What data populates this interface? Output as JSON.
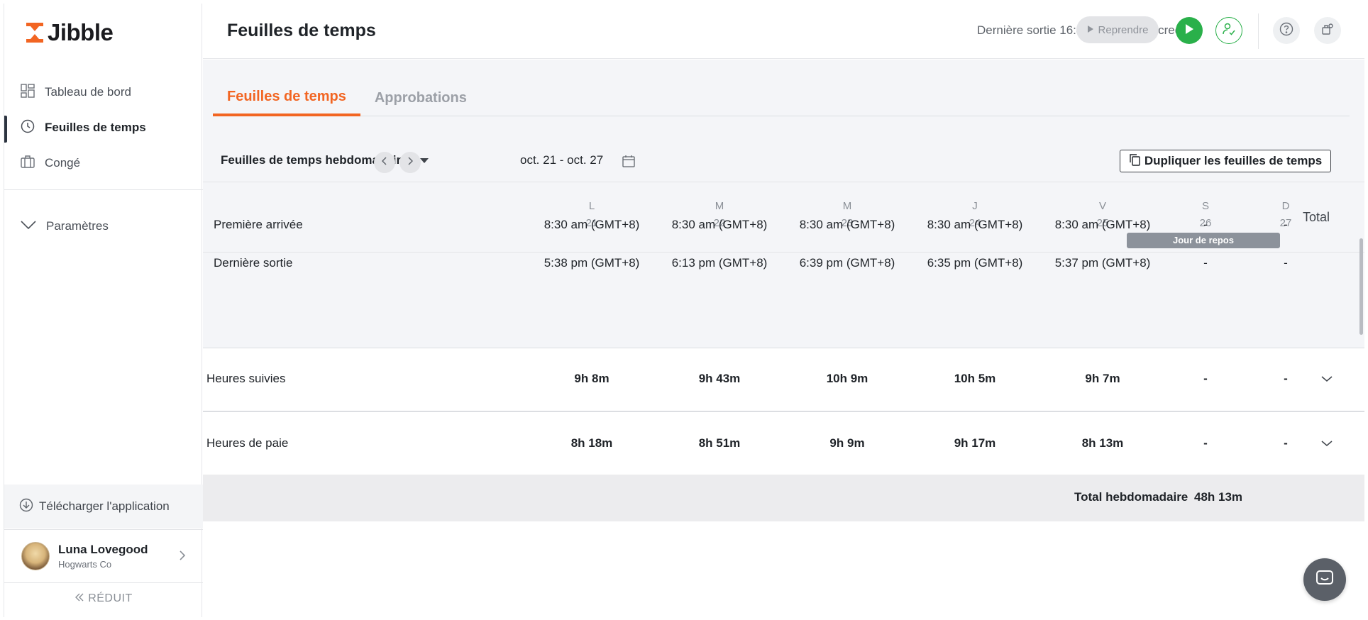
{
  "app": {
    "logo_text": "Jibble",
    "brand_color": "#f26522"
  },
  "sidebar": {
    "items": [
      {
        "label": "Tableau de bord",
        "icon": "dashboard-icon"
      },
      {
        "label": "Feuilles de temps",
        "icon": "clock-icon",
        "active": true
      },
      {
        "label": "Congé",
        "icon": "suitcase-icon"
      }
    ],
    "settings_label": "Paramètres",
    "download_label": "Télécharger l'application",
    "user": {
      "name": "Luna Lovegood",
      "org": "Hogwarts Co"
    },
    "collapse_label": "RÉDUIT"
  },
  "header": {
    "title": "Feuilles de temps",
    "last_out": "Dernière sortie 16:41, dernier mercredi",
    "resume_label": "Reprendre"
  },
  "tabs": [
    {
      "label": "Feuilles de temps",
      "active": true
    },
    {
      "label": "Approbations",
      "active": false
    }
  ],
  "toolbar": {
    "period": "Feuilles de temps hebdomadaires",
    "date_range": "oct. 21 - oct. 27",
    "duplicate_label": "Dupliquer les feuilles de temps"
  },
  "days": [
    {
      "letter": "L",
      "num": "21"
    },
    {
      "letter": "M",
      "num": "22"
    },
    {
      "letter": "M",
      "num": "23"
    },
    {
      "letter": "J",
      "num": "24"
    },
    {
      "letter": "V",
      "num": "25"
    },
    {
      "letter": "S",
      "num": "26"
    },
    {
      "letter": "D",
      "num": "27"
    }
  ],
  "total_header": "Total",
  "rest_badge": "Jour de repos",
  "rows": {
    "first_in": {
      "label": "Première arrivée",
      "values": [
        "8:30 am (GMT+8)",
        "8:30 am (GMT+8)",
        "8:30 am (GMT+8)",
        "8:30 am (GMT+8)",
        "8:30 am (GMT+8)",
        "-",
        "-"
      ]
    },
    "last_out": {
      "label": "Dernière sortie",
      "values": [
        "5:38 pm (GMT+8)",
        "6:13 pm (GMT+8)",
        "6:39 pm (GMT+8)",
        "6:35 pm (GMT+8)",
        "5:37 pm (GMT+8)",
        "-",
        "-"
      ]
    },
    "tracked": {
      "label": "Heures suivies",
      "values": [
        "9h 8m",
        "9h 43m",
        "10h 9m",
        "10h 5m",
        "9h 7m",
        "-",
        "-"
      ]
    },
    "payroll": {
      "label": "Heures de paie",
      "values": [
        "8h 18m",
        "8h 51m",
        "9h 9m",
        "9h 17m",
        "8h 13m",
        "-",
        "-"
      ]
    }
  },
  "weekly": {
    "label": "Total hebdomadaire",
    "value": "48h 13m"
  }
}
